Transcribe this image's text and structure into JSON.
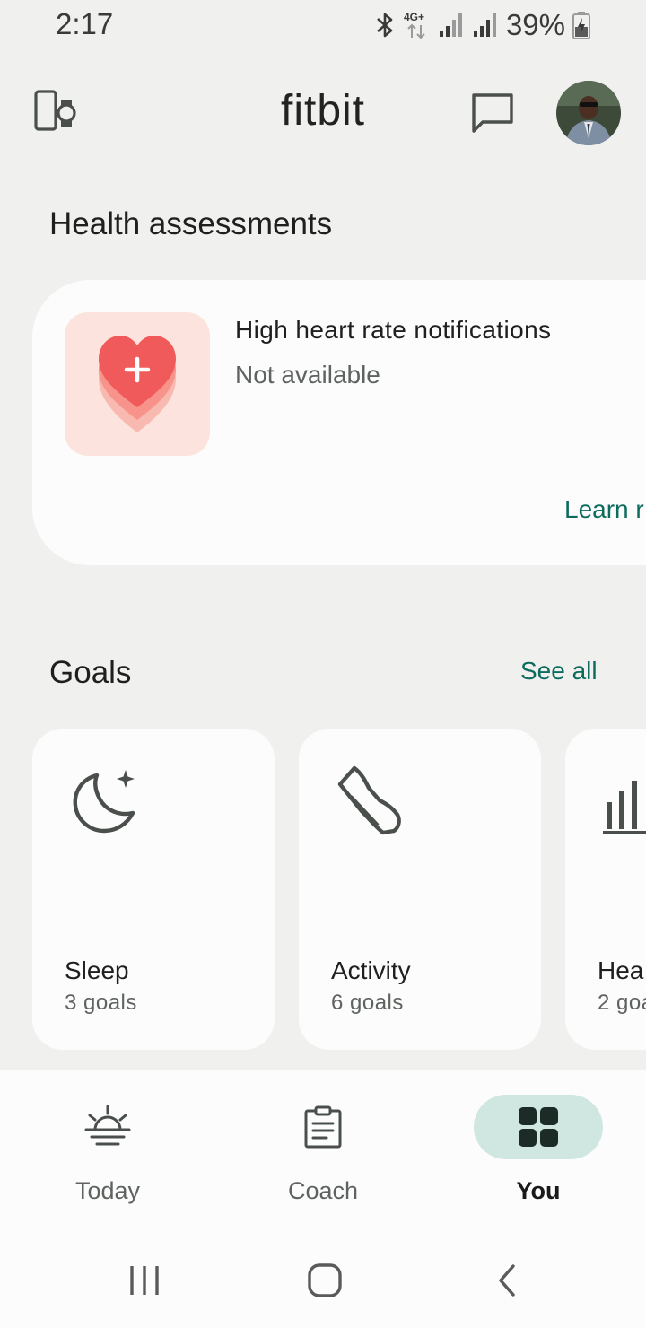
{
  "status_bar": {
    "time": "2:17",
    "network": "4G+",
    "battery": "39%"
  },
  "app_bar": {
    "logo": "fitbit",
    "devices_icon": "devices-icon",
    "chat_icon": "chat-icon",
    "avatar": "profile-avatar"
  },
  "health_assessments": {
    "title": "Health assessments",
    "card": {
      "title": "High heart rate notifications",
      "status": "Not available",
      "link": "Learn r"
    }
  },
  "goals": {
    "title": "Goals",
    "see_all": "See all",
    "items": [
      {
        "name": "Sleep",
        "count": "3 goals",
        "icon": "moon-icon"
      },
      {
        "name": "Activity",
        "count": "6 goals",
        "icon": "shoe-icon"
      },
      {
        "name": "Hea",
        "count": "2 goa",
        "icon": "bar-chart-icon"
      }
    ]
  },
  "bottom_nav": {
    "items": [
      {
        "label": "Today",
        "icon": "sunrise-icon",
        "active": false
      },
      {
        "label": "Coach",
        "icon": "clipboard-icon",
        "active": false
      },
      {
        "label": "You",
        "icon": "grid-icon",
        "active": true
      }
    ]
  },
  "colors": {
    "accent": "#0d6b5e",
    "background": "#f0f1ef",
    "card": "#fbfcfb",
    "active_pill": "#cfe7e0",
    "heart_tile": "#fde3dd",
    "heart": "#f05a5a"
  }
}
